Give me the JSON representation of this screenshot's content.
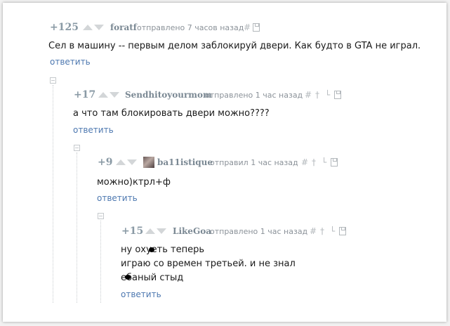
{
  "colors": {
    "rating": "#8a9aa5",
    "username": "#7a8893",
    "reply_link": "#4d78b0",
    "text": "#1a1a1a"
  },
  "comments": [
    {
      "rating": "+125",
      "user": "foratf",
      "meta": "отправлено 7 часов назад",
      "tools": [
        "hash-icon",
        "save-icon"
      ],
      "lines": [
        "Сел в машину -- первым делом заблокируй двери. Как будто в GTA не играл."
      ],
      "reply": "ответить"
    },
    {
      "rating": "+17",
      "user": "Sendhitoyourmom",
      "meta": "отправлено 1 час назад",
      "tools": [
        "hash-icon",
        "parent-icon",
        "branch-icon",
        "save-icon"
      ],
      "lines": [
        "а что там блокировать двери можно????"
      ],
      "reply": "ответить"
    },
    {
      "rating": "+9",
      "user": "ba11istique",
      "meta": "отправил 1 час назад",
      "tools": [
        "hash-icon",
        "parent-icon",
        "branch-icon",
        "save-icon"
      ],
      "lines": [
        "можно)ктрл+ф"
      ],
      "reply": "ответить"
    },
    {
      "rating": "+15",
      "user": "LikeGoa",
      "meta": "отправлено 1 час назад",
      "tools": [
        "hash-icon",
        "parent-icon",
        "branch-icon",
        "save-icon"
      ],
      "lines": [
        "ну охуеть теперь",
        "играю со времен третьей. и не знал",
        "ебаный стыд"
      ],
      "reply": "ответить"
    }
  ]
}
